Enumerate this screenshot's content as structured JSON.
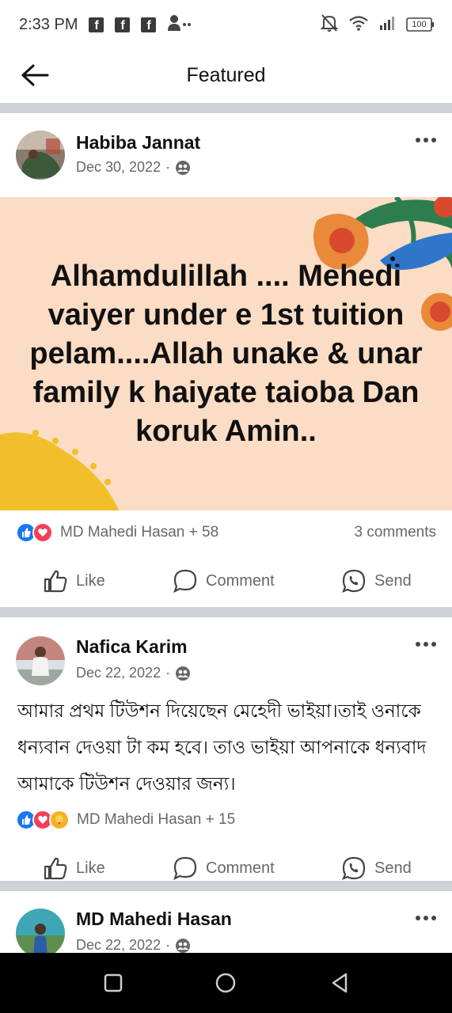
{
  "status_bar": {
    "time": "2:33 PM",
    "notification_icons": [
      "facebook-icon",
      "facebook-icon",
      "facebook-icon",
      "add-friend-icon"
    ],
    "fb_letter": "f",
    "battery": "100"
  },
  "header": {
    "title": "Featured"
  },
  "posts": [
    {
      "author": "Habiba Jannat",
      "date": "Dec 30, 2022",
      "separator": "·",
      "privacy_icon": "friends-icon",
      "text": "Alhamdulillah .... Mehedi vaiyer under e 1st tuition pelam....Allah unake & unar family k haiyate taioba Dan koruk Amin..",
      "reactions": "MD Mahedi Hasan + 58",
      "comments": "3 comments"
    },
    {
      "author": "Nafica Karim",
      "date": "Dec 22, 2022",
      "separator": "·",
      "privacy_icon": "friends-icon",
      "text": "আমার প্রথম টিউশন দিয়েছেন মেহেদী ভাইয়া।তাই ওনাকে ধন্যবান দেওয়া টা কম হবে। তাও ভাইয়া আপনাকে ধন্যবাদ আমাকে টিউশন দেওয়ার জন্য।",
      "reactions": "MD Mahedi Hasan + 15"
    },
    {
      "author": "MD Mahedi Hasan",
      "date": "Dec 22, 2022",
      "separator": "·",
      "privacy_icon": "friends-icon"
    }
  ],
  "actions": {
    "like": "Like",
    "comment": "Comment",
    "send": "Send"
  },
  "colors": {
    "like_blue": "#1877f2",
    "love_red": "#f33e58",
    "post_bg": "#fbdcc4",
    "divider": "#cfd2d6"
  }
}
